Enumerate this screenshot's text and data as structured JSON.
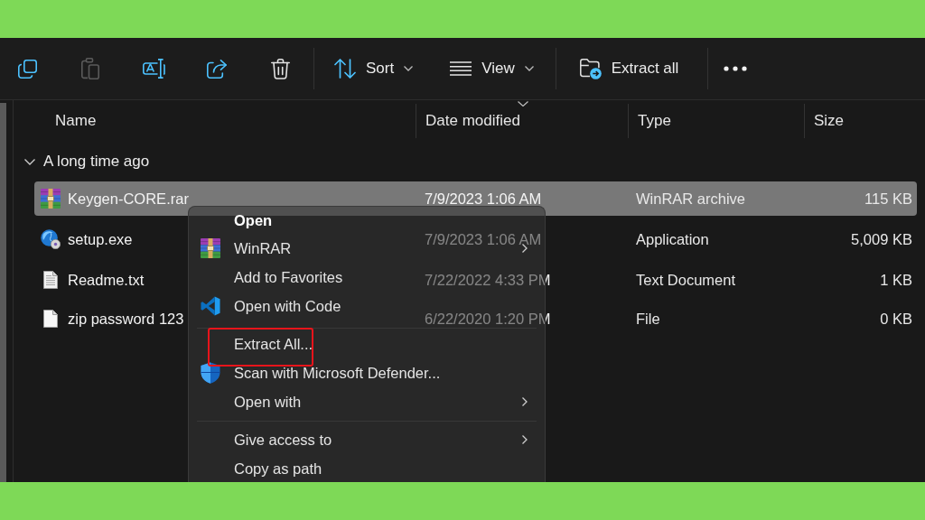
{
  "toolbar": {
    "icon_buttons": [
      {
        "disabled": false
      },
      {
        "disabled": true
      },
      {
        "disabled": false
      },
      {
        "disabled": false
      },
      {
        "disabled": false
      }
    ],
    "labeled_buttons": [
      {
        "label": "Sort",
        "dropdown": true
      },
      {
        "label": "View",
        "dropdown": true
      },
      {
        "label": "Extract all",
        "dropdown": false
      }
    ]
  },
  "columns": [
    {
      "label": "Name",
      "sorted": false
    },
    {
      "label": "Date modified",
      "sorted": true
    },
    {
      "label": "Type",
      "sorted": false
    },
    {
      "label": "Size",
      "sorted": false
    }
  ],
  "group": {
    "label": "A long time ago",
    "expanded": true
  },
  "rows": [
    {
      "kind": "archive",
      "name": "Keygen-CORE.rar",
      "date": "7/9/2023 1:06 AM",
      "type": "WinRAR archive",
      "size": "115 KB",
      "selected": true
    },
    {
      "kind": "installer",
      "name": "setup.exe",
      "date": "7/9/2023 1:06 AM",
      "type": "Application",
      "size": "5,009 KB",
      "selected": false
    },
    {
      "kind": "text",
      "name": "Readme.txt",
      "date": "7/22/2022 4:33 PM",
      "type": "Text Document",
      "size": "1 KB",
      "selected": false
    },
    {
      "kind": "file",
      "name": "zip password 123",
      "date": "6/22/2020 1:20 PM",
      "type": "File",
      "size": "0 KB",
      "selected": false
    }
  ],
  "context_menu": {
    "items": [
      {
        "kind": "command",
        "label": "Open",
        "default": true,
        "submenu": false,
        "highlighted": false
      },
      {
        "kind": "command",
        "label": "WinRAR",
        "default": false,
        "submenu": true,
        "highlighted": false
      },
      {
        "kind": "command",
        "label": "Add to Favorites",
        "default": false,
        "submenu": false,
        "highlighted": false
      },
      {
        "kind": "command",
        "label": "Open with Code",
        "default": false,
        "submenu": false,
        "highlighted": false
      },
      {
        "kind": "separator"
      },
      {
        "kind": "command",
        "label": "Extract All...",
        "default": false,
        "submenu": false,
        "highlighted": true
      },
      {
        "kind": "command",
        "label": "Scan with Microsoft Defender...",
        "default": false,
        "submenu": false,
        "highlighted": false
      },
      {
        "kind": "command",
        "label": "Open with",
        "default": false,
        "submenu": true,
        "highlighted": false
      },
      {
        "kind": "separator"
      },
      {
        "kind": "command",
        "label": "Give access to",
        "default": false,
        "submenu": true,
        "highlighted": false
      },
      {
        "kind": "command",
        "label": "Copy as path",
        "default": false,
        "submenu": false,
        "highlighted": false
      }
    ]
  }
}
